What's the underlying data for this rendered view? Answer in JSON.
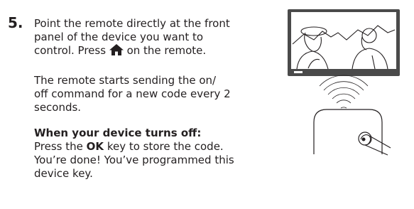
{
  "step": {
    "number": "5."
  },
  "instruction": {
    "line1": "Point the remote directly at the front",
    "line2": "panel of the device you want to",
    "line3a": "control. Press",
    "home_icon": "home-icon",
    "line3b": "on the remote."
  },
  "status": {
    "line1": "The remote starts sending the on/",
    "line2": "off command for a new code every 2",
    "line3": "seconds."
  },
  "result": {
    "heading": "When your device turns off:",
    "line1a": "Press the",
    "key": "OK",
    "line1b": "key to store the code.",
    "line2": "You’re done! You’ve programmed this",
    "line3": "device key."
  },
  "illustration": {
    "icons": [
      "tv-icon",
      "ir-signal-icon",
      "remote-icon",
      "finger-press-icon"
    ]
  }
}
